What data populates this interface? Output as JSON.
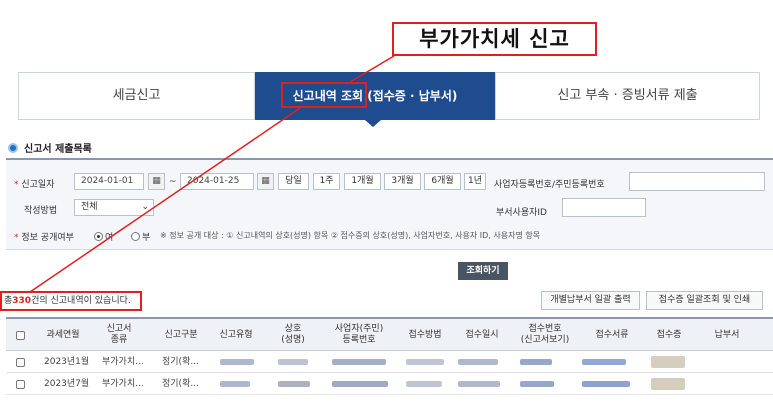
{
  "callout": {
    "title": "부가가치세 신고"
  },
  "tabs": [
    {
      "label": "세금신고"
    },
    {
      "label_main": "신고내역 조회",
      "label_sub": "(접수증 · 납부서)"
    },
    {
      "label": "신고 부속 · 증빙서류 제출"
    }
  ],
  "section": {
    "title": "신고서 제출목록"
  },
  "search": {
    "date_label": "신고일자",
    "date_from": "2024-01-01",
    "date_sep": "~",
    "date_to": "2024-01-25",
    "calendar_glyph": "▦",
    "periods": [
      "당일",
      "1주",
      "1개월",
      "3개월",
      "6개월",
      "1년"
    ],
    "bizno_label": "사업자등록번호/주민등록번호",
    "bizno_value": "",
    "method_label": "작성방법",
    "method_value": "전체",
    "user_id_label": "부서사용자ID",
    "user_id_value": "",
    "disclosure_label": "정보 공개여부",
    "yes_label": "여",
    "no_label": "부",
    "note": "※ 정보 공개 대상 : ① 신고내역의 상호(성명) 항목 ② 접수증의 상호(성명), 사업자번호, 사용자 ID, 사용자명 항목",
    "search_button": "조회하기",
    "required_mark": "*"
  },
  "results": {
    "count_prefix": "총",
    "count": "330",
    "count_suffix": "건의 신고내역이 있습니다.",
    "bulk_payment_button": "개별납부서 일괄 출력",
    "bulk_receipt_button": "접수증 일괄조회 및 인쇄"
  },
  "table": {
    "headers": [
      "과세연월",
      "신고서\n종류",
      "신고구분",
      "신고유형",
      "상호\n(성명)",
      "사업자(주민)\n등록번호",
      "접수방법",
      "접수일시",
      "접수번호\n(신고서보기)",
      "접수서류",
      "접수증",
      "납부서"
    ],
    "rows": [
      {
        "period": "2023년1월",
        "kind": "부가가치...",
        "division": "정기(확..."
      },
      {
        "period": "2023년7월",
        "kind": "부가가치...",
        "division": "정기(확..."
      }
    ]
  },
  "colors": {
    "accent": "#1f4b8f",
    "highlight": "#e02020",
    "link": "#1f6fc5"
  }
}
